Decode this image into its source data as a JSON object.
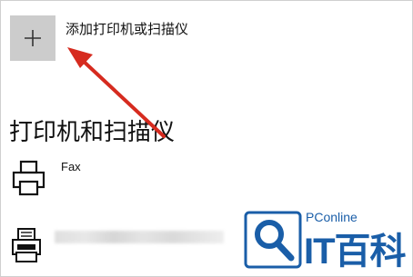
{
  "add_device": {
    "label": "添加打印机或扫描仪",
    "icon": "plus-icon"
  },
  "section": {
    "title": "打印机和扫描仪"
  },
  "devices": [
    {
      "name": "Fax",
      "icon": "printer-icon"
    },
    {
      "name": "",
      "icon": "multifunction-printer-icon"
    }
  ],
  "annotation": {
    "icon": "red-arrow-icon",
    "color": "#d62b1f"
  },
  "watermark": {
    "small": "PConline",
    "big": "IT百科",
    "logo": "pconline-search-logo",
    "color": "#1a5ea8"
  }
}
